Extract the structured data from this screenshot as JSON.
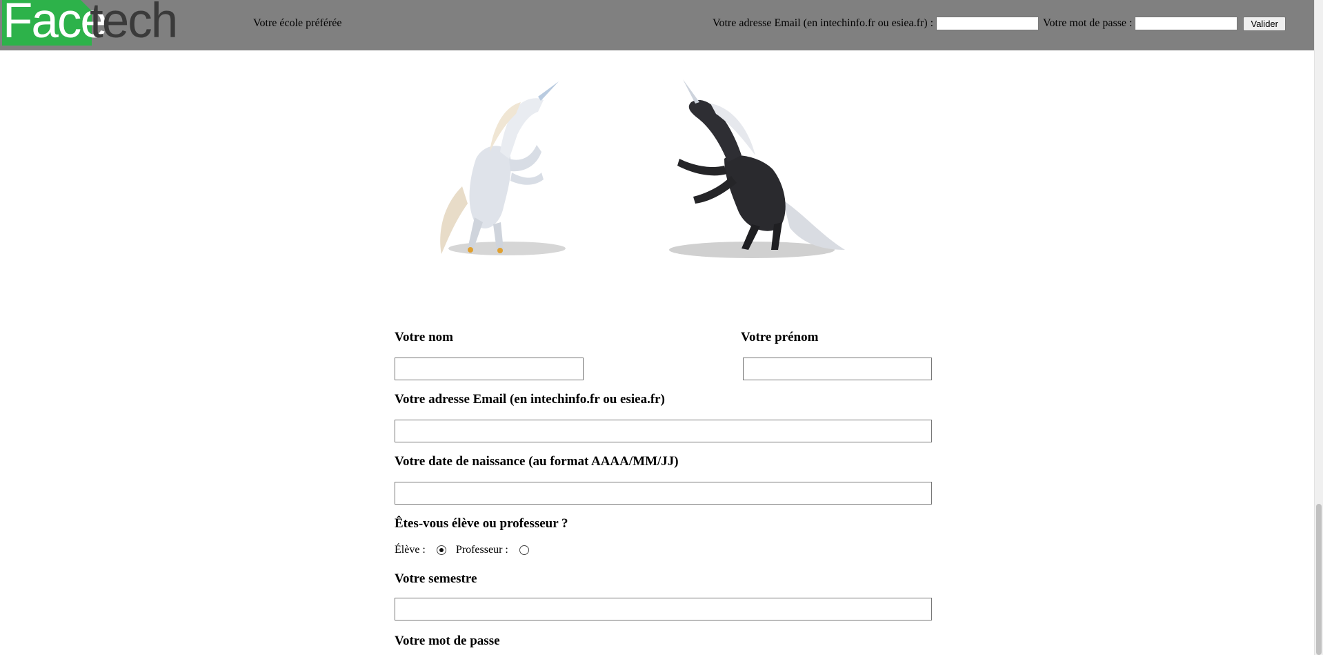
{
  "header": {
    "logo_face": "Face",
    "logo_tech": "tech",
    "tagline": "Votre école préférée",
    "email_label": "Votre adresse Email (en intechinfo.fr ou esiea.fr) :",
    "email_value": "",
    "password_label": "Votre mot de passe :",
    "password_value": "",
    "submit_label": "Valider"
  },
  "hero": {
    "left_image": "white-unicorn",
    "right_image": "black-unicorn"
  },
  "form": {
    "last_name_label": "Votre nom",
    "last_name_value": "",
    "first_name_label": "Votre prénom",
    "first_name_value": "",
    "email_label": "Votre adresse Email (en intechinfo.fr ou esiea.fr)",
    "email_value": "",
    "birthdate_label": "Votre date de naissance (au format AAAA/MM/JJ)",
    "birthdate_value": "",
    "role_question": "Êtes-vous élève ou professeur ?",
    "role_options": [
      {
        "label": "Élève :",
        "checked": true
      },
      {
        "label": "Professeur :",
        "checked": false
      }
    ],
    "semester_label": "Votre semestre",
    "semester_value": "",
    "password_label": "Votre mot de passe"
  },
  "colors": {
    "header_bg": "#808080",
    "logo_green": "#2db24a",
    "logo_dark": "#3a3a3a"
  }
}
